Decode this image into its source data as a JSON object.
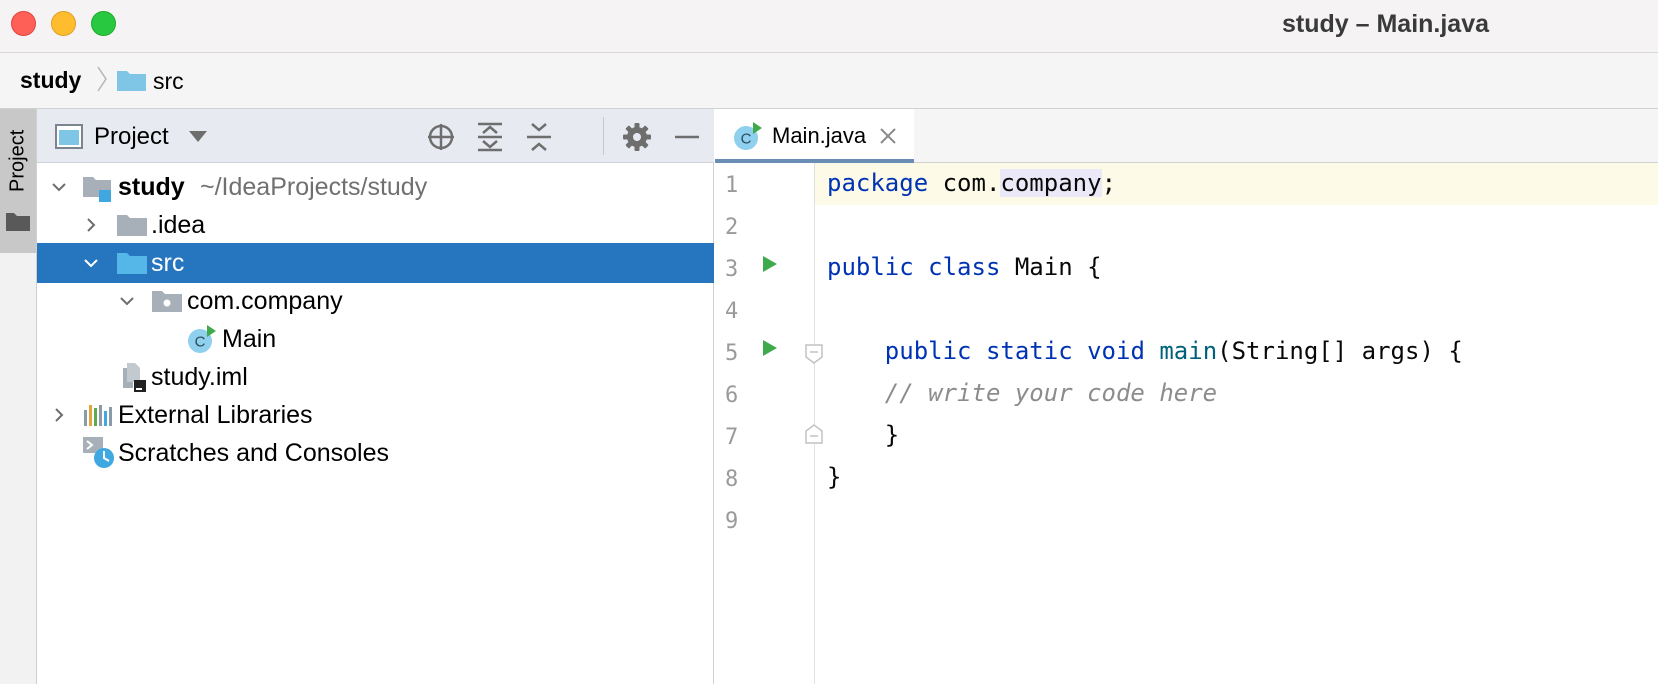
{
  "window": {
    "title": "study – Main.java"
  },
  "navbar": {
    "root": "study",
    "folder": "src"
  },
  "stripe": {
    "label": "Project"
  },
  "project_panel": {
    "title": "Project",
    "tools": [
      "locate-icon",
      "expand-all-icon",
      "collapse-all-icon",
      "gear-icon",
      "minimize-icon"
    ],
    "tree": [
      {
        "label": "study",
        "hint": "~/IdeaProjects/study",
        "icon": "module-folder-icon",
        "expanded": true
      },
      {
        "label": ".idea",
        "icon": "folder-icon",
        "expanded": false
      },
      {
        "label": "src",
        "icon": "source-folder-icon",
        "expanded": true,
        "selected": true
      },
      {
        "label": "com.company",
        "icon": "package-icon",
        "expanded": true
      },
      {
        "label": "Main",
        "icon": "java-class-icon"
      },
      {
        "label": "study.iml",
        "icon": "iml-file-icon"
      },
      {
        "label": "External Libraries",
        "icon": "libraries-icon",
        "expanded": false
      },
      {
        "label": "Scratches and Consoles",
        "icon": "scratches-icon"
      }
    ]
  },
  "editor": {
    "tab": {
      "label": "Main.java"
    },
    "line_numbers": [
      "1",
      "2",
      "3",
      "4",
      "5",
      "6",
      "7",
      "8",
      "9"
    ],
    "code": {
      "l1_kw": "package",
      "l1_pre": " com.",
      "l1_hl": "company",
      "l1_post": ";",
      "l3_kw1": "public",
      "l3_kw2": "class",
      "l3_rest": " Main {",
      "l5_indent": "    ",
      "l5_kw1": "public",
      "l5_kw2": "static",
      "l5_kw3": "void",
      "l5_fn": "main",
      "l5_rest": "(String[] args) {",
      "l6_comment": "    // write your code here",
      "l7": "    }",
      "l8": "}"
    },
    "colors": {
      "keyword": "#0033b3",
      "function": "#00627a",
      "comment": "#8c8c8c",
      "selection": "#2675bf"
    }
  }
}
